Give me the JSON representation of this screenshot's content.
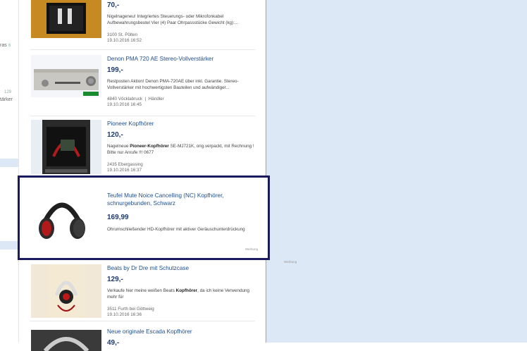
{
  "sidebar_fragments": {
    "frag1": "ras",
    "frag1b": "6",
    "frag2": "129",
    "frag3": "tärker"
  },
  "listings": [
    {
      "price": "70,-",
      "desc": "Nigelnageneu! Integriertes Steuerungs- oder Mikrofonkabel Aufbewahrungsbeutel Vier (4) Paar Ohrpassstücke Gewicht (kg):...",
      "location": "3100 St. Pölten",
      "date": "19.10.2016 16:52"
    },
    {
      "title": "Denon PMA 720 AE Stereo-Vollverstärker",
      "price": "199,-",
      "desc": "Restposten Aktion! Denon PMA-720AE über inkl. Garantie. Stereo-Vollverstärker mit hochwertigsten Bauteilen und aufwändiger...",
      "location": "4840 Vöcklabruck",
      "seller": "Händler",
      "date": "19.10.2016 16:45"
    },
    {
      "title": "Pioneer Kopfhörer",
      "price": "120,-",
      "desc_pre": "Nagelneue ",
      "desc_bold": "Pioneer-Kopfhörer",
      "desc_post": " SE-MJ721K, orig.verpackt, mit Rechnung ! Bitte nur Anrufe !!! 0677",
      "location": "2435 Ebergassing",
      "date": "19.10.2016 16:37"
    }
  ],
  "ad": {
    "title": "Teufel Mute Noice Cancelling (NC) Kopfhörer, schnurgebunden, Schwarz",
    "price": "169,99",
    "desc": "Ohrumschließender HD-Kopfhörer mit aktiver Geräuschunterdrückung",
    "label": "Werbung",
    "outside_label": "Werbung"
  },
  "listings_after": [
    {
      "title": "Beats by Dr Dre mit Schutzcase",
      "price": "129,-",
      "desc_pre": "Verkaufe hier meine weißen Beats ",
      "desc_bold": "Kopfhörer",
      "desc_post": ", da ich keine Verwendung mehr für",
      "location": "3511 Furth bei Göttweig",
      "date": "19.10.2016 16:36"
    },
    {
      "title": "Neue originale Escada Kopfhörer",
      "price": "49,-"
    }
  ],
  "colors": {
    "link": "#1e4e8c",
    "price": "#1e3a6e",
    "right_panel": "#dce8f6",
    "ad_border": "#1a1a5e"
  }
}
